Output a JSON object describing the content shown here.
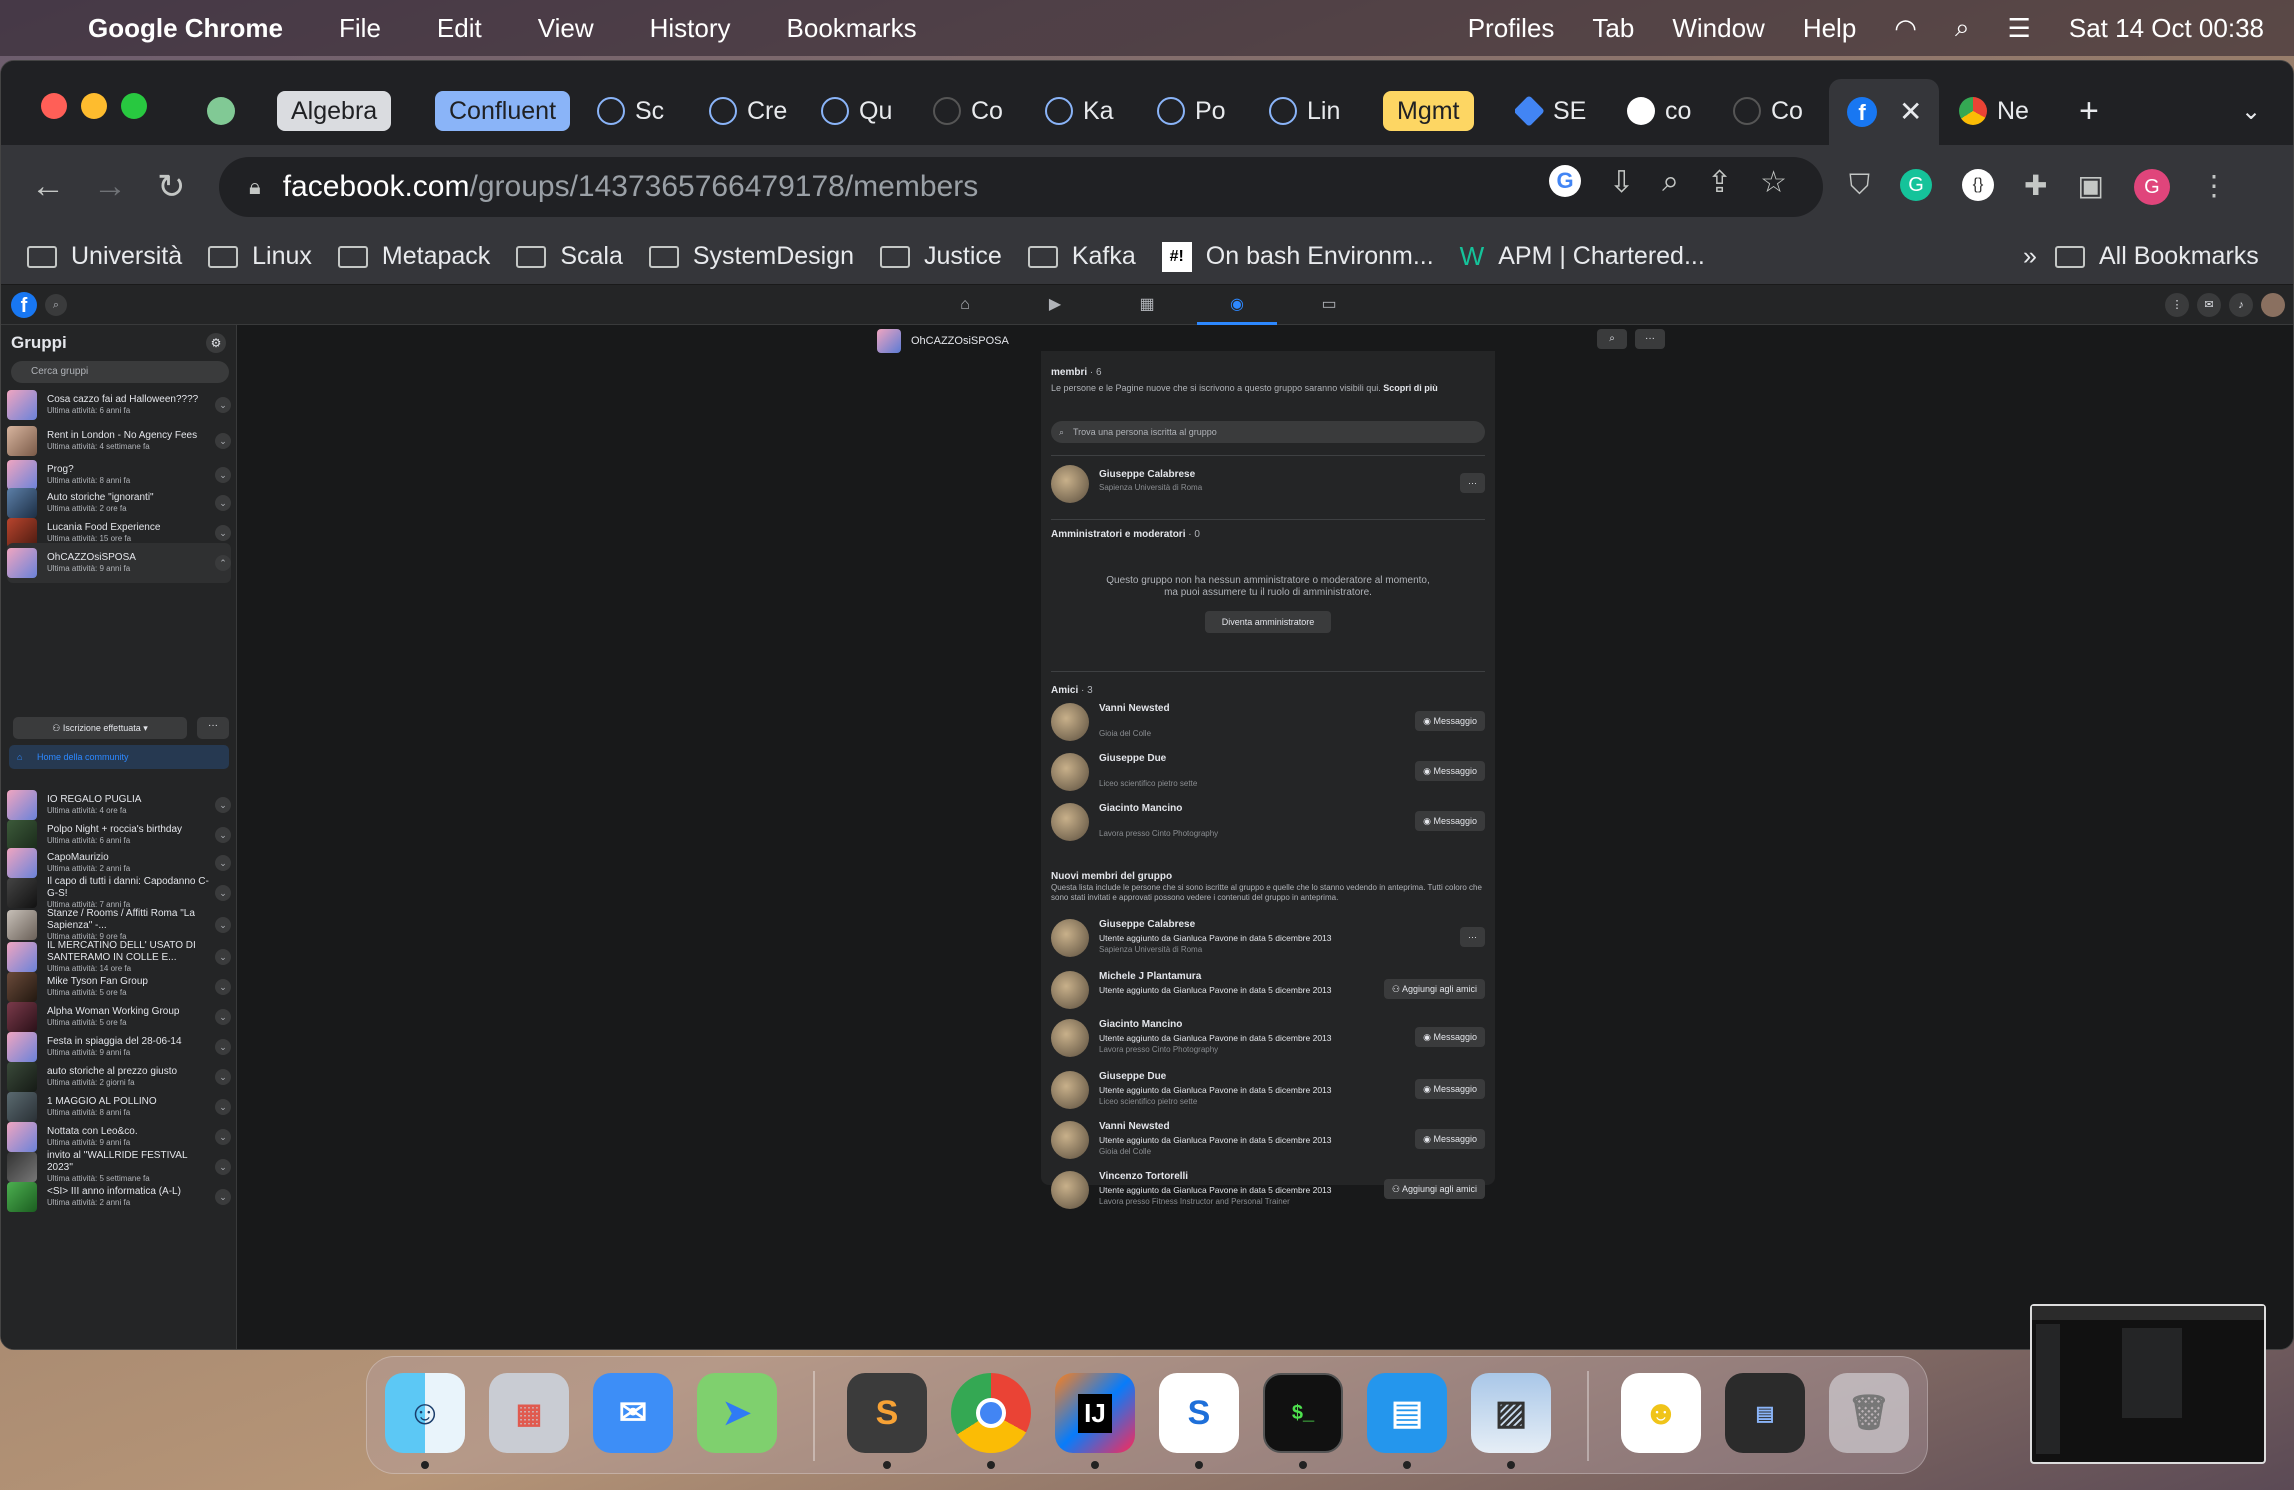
{
  "menubar": {
    "app": "Google Chrome",
    "items": [
      "File",
      "Edit",
      "View",
      "History",
      "Bookmarks"
    ],
    "right_items": [
      "Profiles",
      "Tab",
      "Window",
      "Help"
    ],
    "clock": "Sat 14 Oct  00:38"
  },
  "tabs": {
    "groups": [
      {
        "label": "Algebra",
        "color": "#dadce0"
      },
      {
        "label": "Confluent",
        "color": "#8ab4f8"
      },
      {
        "label": "Mgmt",
        "color": "#fdd663"
      }
    ],
    "items": [
      "Sc",
      "Cre",
      "Qu",
      "Co",
      "Ka",
      "Po",
      "Lin",
      "SE",
      "co",
      "Co",
      "Ne"
    ],
    "new_tab": "+"
  },
  "omnibox": {
    "host": "facebook.com",
    "path": "/groups/1437365766479178/members"
  },
  "bookmarks": {
    "items": [
      "Università",
      "Linux",
      "Metapack",
      "Scala",
      "SystemDesign",
      "Justice",
      "Kafka",
      "On bash Environm...",
      "APM | Chartered..."
    ],
    "overflow": "»",
    "all": "All Bookmarks"
  },
  "sidebar": {
    "title": "Gruppi",
    "search_placeholder": "Cerca gruppi",
    "groups": [
      {
        "name": "Cosa cazzo fai ad Halloween????",
        "sub": "Ultima attività: 6 anni fa"
      },
      {
        "name": "Rent in London - No Agency Fees",
        "sub": "Ultima attività: 4 settimane fa"
      },
      {
        "name": "Prog?",
        "sub": "Ultima attività: 8 anni fa"
      },
      {
        "name": "Auto storiche \"ignoranti\"",
        "sub": "Ultima attività: 2 ore fa"
      },
      {
        "name": "Lucania Food Experience",
        "sub": "Ultima attività: 15 ore fa"
      },
      {
        "name": "OhCAZZOsiSPOSA",
        "sub": "Ultima attività: 9 anni fa"
      }
    ],
    "membership_button": "Iscrizione effettuata",
    "more_button": "···",
    "community_home": "Home della community",
    "groups_after": [
      {
        "name": "IO REGALO PUGLIA",
        "sub": "Ultima attività: 4 ore fa"
      },
      {
        "name": "Polpo Night + roccia's birthday",
        "sub": "Ultima attività: 6 anni fa"
      },
      {
        "name": "CapoMaurizio",
        "sub": "Ultima attività: 2 anni fa"
      },
      {
        "name": "Il capo di tutti i danni: Capodanno C-G-S!",
        "sub": "Ultima attività: 7 anni fa"
      },
      {
        "name": "Stanze / Rooms / Affitti Roma \"La Sapienza\" -...",
        "sub": "Ultima attività: 9 ore fa"
      },
      {
        "name": "IL MERCATINO DELL' USATO DI SANTERAMO IN COLLE E...",
        "sub": "Ultima attività: 14 ore fa"
      },
      {
        "name": "Mike Tyson Fan Group",
        "sub": "Ultima attività: 5 ore fa"
      },
      {
        "name": "Alpha Woman Working Group",
        "sub": "Ultima attività: 5 ore fa"
      },
      {
        "name": "Festa in spiaggia del 28-06-14",
        "sub": "Ultima attività: 9 anni fa"
      },
      {
        "name": "auto storiche al prezzo giusto",
        "sub": "Ultima attività: 2 giorni fa"
      },
      {
        "name": "1 MAGGIO AL POLLINO",
        "sub": "Ultima attività: 8 anni fa"
      },
      {
        "name": "Nottata con Leo&co.",
        "sub": "Ultima attività: 9 anni fa"
      },
      {
        "name": "invito al ''WALLRIDE FESTIVAL 2023''",
        "sub": "Ultima attività: 5 settimane fa"
      },
      {
        "name": "<SI> III anno informatica (A-L)",
        "sub": "Ultima attività: 2 anni fa"
      }
    ]
  },
  "group_header": {
    "name": "OhCAZZOsiSPOSA",
    "search_btn": "⌕",
    "more_btn": "···"
  },
  "members": {
    "title": "membri",
    "count": " · 6",
    "desc": "Le persone e le Pagine nuove che si iscrivono a questo gruppo saranno visibili qui.",
    "learn_more": "Scopri di più",
    "search_placeholder": "Trova una persona iscritta al gruppo",
    "first": {
      "name": "Giuseppe Calabrese",
      "sub": "Sapienza Università di Roma",
      "btn": "···"
    },
    "admins_title": "Amministratori e moderatori",
    "admins_count": " · 0",
    "admins_text": "Questo gruppo non ha nessun amministratore o moderatore al momento, ma puoi assumere tu il ruolo di amministratore.",
    "become_admin": "Diventa amministratore",
    "friends_title": "Amici",
    "friends_count": " · 3",
    "friends": [
      {
        "name": "Vanni Newsted",
        "sub": "Gioia del Colle",
        "btn": "Messaggio"
      },
      {
        "name": "Giuseppe Due",
        "sub": "Liceo scientifico pietro sette",
        "btn": "Messaggio"
      },
      {
        "name": "Giacinto Mancino",
        "sub": "Lavora presso Cinto Photography",
        "btn": "Messaggio"
      }
    ],
    "new_title": "Nuovi membri del gruppo",
    "new_desc": "Questa lista include le persone che si sono iscritte al gruppo e quelle che lo stanno vedendo in anteprima. Tutti coloro che sono stati invitati e approvati possono vedere i contenuti del gruppo in anteprima.",
    "new_members": [
      {
        "name": "Giuseppe Calabrese",
        "l1": "Utente aggiunto da Gianluca Pavone in data 5 dicembre 2013",
        "l2": "Sapienza Università di Roma",
        "btn": "···"
      },
      {
        "name": "Michele J Plantamura",
        "l1": "Utente aggiunto da Gianluca Pavone in data 5 dicembre 2013",
        "l2": "",
        "btn": "Aggiungi agli amici"
      },
      {
        "name": "Giacinto Mancino",
        "l1": "Utente aggiunto da Gianluca Pavone in data 5 dicembre 2013",
        "l2": "Lavora presso Cinto Photography",
        "btn": "Messaggio"
      },
      {
        "name": "Giuseppe Due",
        "l1": "Utente aggiunto da Gianluca Pavone in data 5 dicembre 2013",
        "l2": "Liceo scientifico pietro sette",
        "btn": "Messaggio"
      },
      {
        "name": "Vanni Newsted",
        "l1": "Utente aggiunto da Gianluca Pavone in data 5 dicembre 2013",
        "l2": "Gioia del Colle",
        "btn": "Messaggio"
      },
      {
        "name": "Vincenzo Tortorelli",
        "l1": "Utente aggiunto da Gianluca Pavone in data 5 dicembre 2013",
        "l2": "Lavora presso Fitness Instructor and Personal Trainer",
        "btn": "Aggiungi agli amici"
      }
    ]
  },
  "colors": {
    "fb_blue": "#1877f2",
    "accent": "#2d88ff"
  }
}
